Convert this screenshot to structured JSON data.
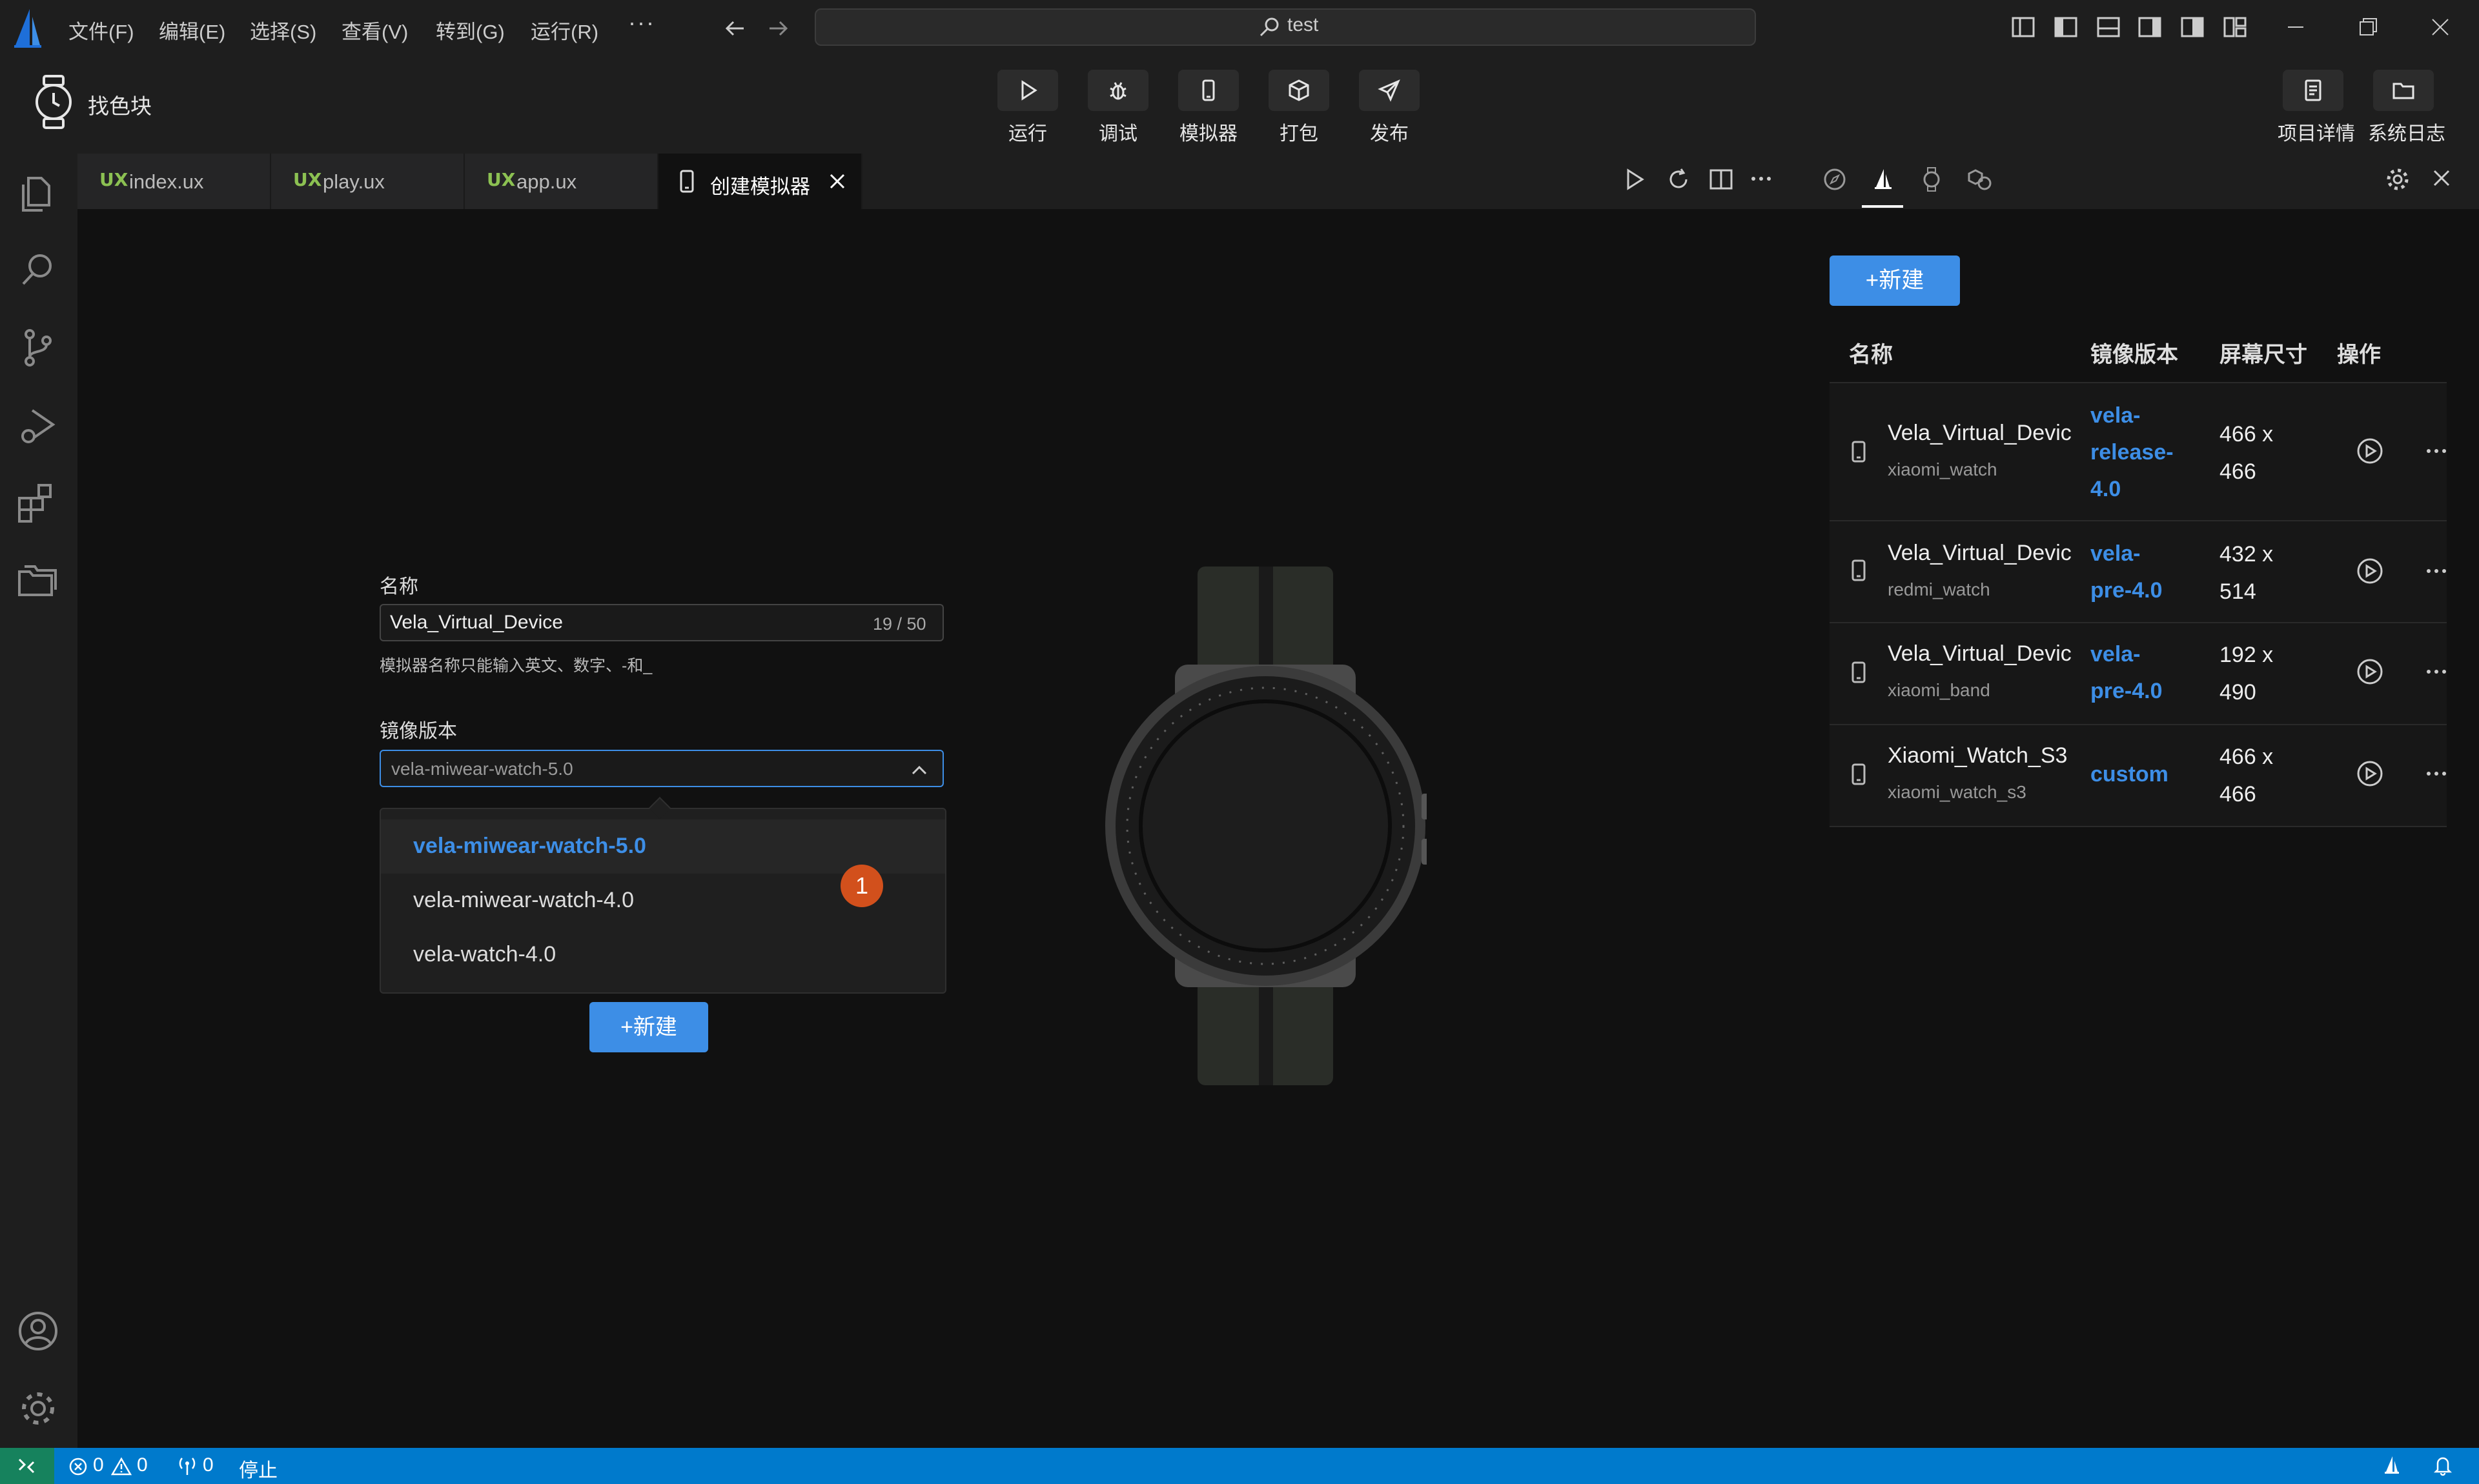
{
  "titlebar": {
    "menus": [
      "文件(F)",
      "编辑(E)",
      "选择(S)",
      "查看(V)",
      "转到(G)",
      "运行(R)"
    ],
    "more": "···",
    "search": "test"
  },
  "toolbar": {
    "project_name": "找色块",
    "run": "运行",
    "debug": "调试",
    "simulator": "模拟器",
    "package": "打包",
    "publish": "发布",
    "project_details": "项目详情",
    "system_log": "系统日志"
  },
  "tabs": [
    {
      "label": "index.ux",
      "icon": "UX"
    },
    {
      "label": "play.ux",
      "icon": "UX"
    },
    {
      "label": "app.ux",
      "icon": "UX"
    },
    {
      "label": "创建模拟器",
      "icon": "phone-icon"
    }
  ],
  "form": {
    "name_label": "名称",
    "name_value": "Vela_Virtual_Device",
    "name_count": "19 / 50",
    "name_hint": "模拟器名称只能输入英文、数字、-和_",
    "mirror_label": "镜像版本",
    "mirror_selected": "vela-miwear-watch-5.0",
    "options": [
      "vela-miwear-watch-5.0",
      "vela-miwear-watch-4.0",
      "vela-watch-4.0"
    ],
    "badge": "1",
    "create_button": "+新建"
  },
  "device_panel": {
    "create_button": "+新建",
    "headers": {
      "name": "名称",
      "mirror": "镜像版本",
      "size": "屏幕尺寸",
      "actions": "操作"
    },
    "rows": [
      {
        "name": "Vela_Virtual_Devic",
        "sub": "xiaomi_watch",
        "mirror": "vela-\nrelease-\n4.0",
        "size": "466 x\n466"
      },
      {
        "name": "Vela_Virtual_Devic",
        "sub": "redmi_watch",
        "mirror": "vela-\npre-4.0",
        "size": "432 x\n514"
      },
      {
        "name": "Vela_Virtual_Devic",
        "sub": "xiaomi_band",
        "mirror": "vela-\npre-4.0",
        "size": "192 x\n490"
      },
      {
        "name": "Xiaomi_Watch_S3",
        "sub": "xiaomi_watch_s3",
        "mirror": "custom",
        "size": "466 x\n466"
      }
    ]
  },
  "statusbar": {
    "errors": "0",
    "warnings": "0",
    "ports": "0",
    "stop": "停止"
  },
  "colors": {
    "accent": "#3d8ee6",
    "statusbar": "#007acc",
    "badge": "#d2501c",
    "background": "#111111"
  }
}
